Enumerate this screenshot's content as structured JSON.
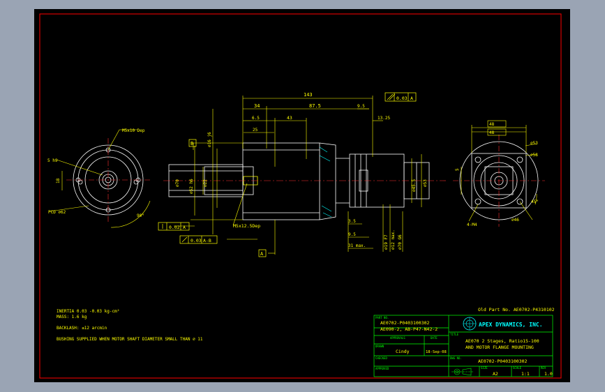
{
  "colors": {
    "background": "#000000",
    "outer_frame": "#ff0000",
    "geometry": "#ffffff",
    "dimensions": "#ffff00",
    "title_block": "#00ff00",
    "centerline": "#ff3030",
    "hatch": "#00ffff"
  },
  "dims": {
    "overall_length": "143",
    "dim_34": "34",
    "dim_875": "87.5",
    "dim_95": "9.5",
    "dim_65": "6.5",
    "dim_25": "25",
    "dim_43": "43",
    "dim_1325": "13.25",
    "flatness_val": "0.03",
    "flatness_ref": "A",
    "dia_16": "⌀16 j6",
    "dia_70": "⌀70",
    "dia_52": "⌀52 h6",
    "dia_22": "⌀22",
    "dia_455": "⌀45.5",
    "dia_53": "⌀53",
    "thread_m5": "M5x12.5Dep",
    "thread_left": "M5x10 Dep",
    "keyway": "5 h9",
    "dim_18": "18",
    "pcd": "PCD ⌀62",
    "angle_90": "90°",
    "dim_35": "3.5",
    "dim_9_5b": "9.5",
    "dim_31max": "31 max.",
    "dia_19": "⌀19 F7",
    "dia_12max": "⌀12 max.",
    "dia_70g6": "⌀70 G6",
    "datum_b": "B",
    "datum_a": "A",
    "runout_val": "0.02",
    "runout_ref": "A",
    "concentric_val": "0.03",
    "concentric_ref": "A-B",
    "sq_48": "48",
    "sq_48b": "48",
    "dia_53r": "⌀53",
    "dia_58r": "⌀58",
    "dim_5r": "5",
    "angle_45": "45°",
    "m4": "4-M4",
    "dia_46r": "⌀46"
  },
  "notes": {
    "inertia": "INERTIA   0.03 -0.03 kg-cm²",
    "mass": "MASS: 1.6 kg",
    "backlash": "BACKLASH: ≤12 arcmin",
    "bushing": "BUSHING SUPPLIED WHEN MOTOR SHAFT DIAMETER SMALL THAN ⌀ 11"
  },
  "title_block": {
    "old_part": "Old Part No. AE0702-P4310102",
    "part_no_label": "PART NO.",
    "part_no_1": "AE0702-P0403100302",
    "part_no_2": "AE090-2, AB-P47-N42-2",
    "approval_label": "APPROVALS",
    "date_label": "DATE",
    "drawn_label": "DRAWN",
    "drawn_by": "Cindy",
    "drawn_date": "18-Sep-08",
    "checked_label": "CHECKED",
    "approved_label": "APPROVED",
    "company": "APEX DYNAMICS, INC.",
    "title_label": "TITLE",
    "title_1": "AE070 2 Stages, Ratio15-100",
    "title_2": "AND MOTOR FLANGE MOUNTING",
    "dwg_no_label": "DWG NO.",
    "dwg_no": "AE0702-P0403100302",
    "size_label": "SIZE",
    "size": "A2",
    "scale_label": "SCALE",
    "scale": "1:1",
    "rev_label": "REV",
    "rev": "1.0"
  }
}
